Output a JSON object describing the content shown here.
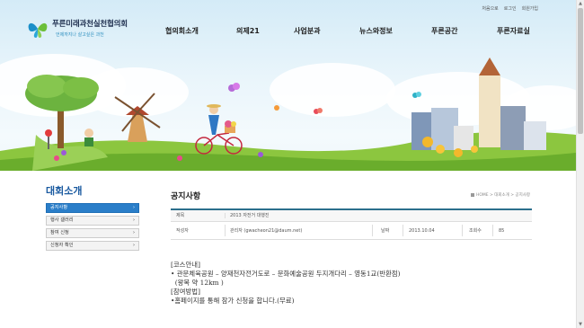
{
  "header": {
    "top_links": [
      "처음으로",
      "로그인",
      "회원가입"
    ],
    "logo_name": "푸른미래과천실천협의회",
    "logo_slogan": "언제까지나 살고싶은 과천",
    "gnb": [
      "협의회소개",
      "의제21",
      "사업분과",
      "뉴스와정보",
      "푸른공간",
      "푸른자료실"
    ]
  },
  "sidebar": {
    "title": "대회소개",
    "items": [
      {
        "label": "공지사항",
        "active": true
      },
      {
        "label": "행사 갤러리",
        "active": false
      },
      {
        "label": "참여 신청",
        "active": false
      },
      {
        "label": "신청자 확인",
        "active": false
      }
    ]
  },
  "main": {
    "page_title": "공지사항",
    "breadcrumb": "HOME > 대회소개 > 공지사항",
    "post": {
      "subject_label": "제목",
      "subject": "2013 자전거 대행진",
      "author_label": "작성자",
      "author": "관리자 (gwacheon21@daum.net)",
      "date_label": "날짜",
      "date": "2013.10.04",
      "views_label": "조회수",
      "views": "85",
      "body": [
        "[코스안내]",
        "",
        "• 관문체육공원 – 양재천자전거도로 – 문화예술공원 두지개다리 – 영동1교(반환점)",
        "  (왕복 약 12km )",
        "[참여방법]",
        "",
        "•홈페이지를 통해 참가 신청을 합니다.(무료)"
      ]
    }
  },
  "colors": {
    "accent": "#2a7ec9",
    "title_blue": "#1a5aa0",
    "rule": "#2c6f8c"
  }
}
